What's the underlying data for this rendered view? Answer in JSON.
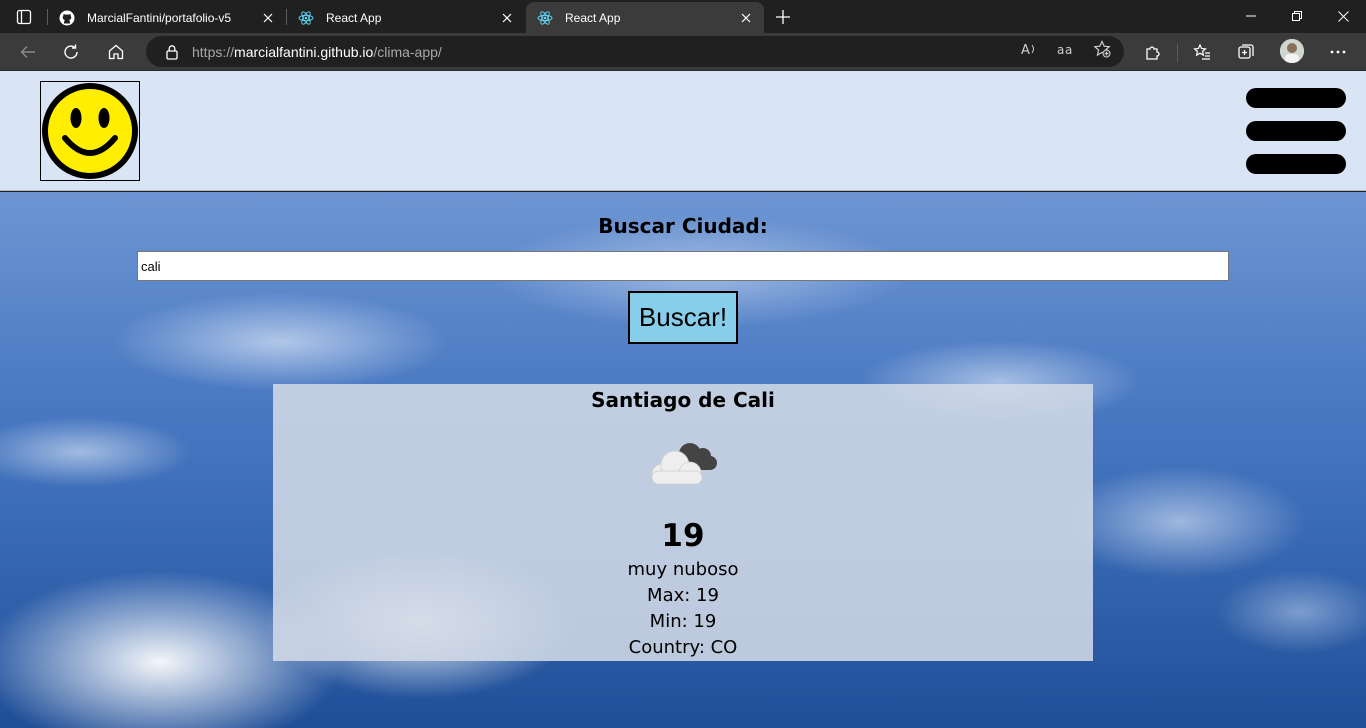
{
  "browser": {
    "tabs": [
      {
        "title": "MarcialFantini/portafolio-v5",
        "icon": "github-icon",
        "active": false
      },
      {
        "title": "React App",
        "icon": "react-icon",
        "active": false
      },
      {
        "title": "React App",
        "icon": "react-icon",
        "active": true
      }
    ],
    "url_prefix": "https://",
    "url_host": "marcialfantini.github.io",
    "url_path": "/clima-app/"
  },
  "app": {
    "logo_icon": "smiley-face-icon",
    "menu_icon": "hamburger-menu-icon",
    "search": {
      "title": "Buscar Ciudad:",
      "value": "cali",
      "button_label": "Buscar!"
    },
    "weather": {
      "city": "Santiago de Cali",
      "icon": "cloudy-icon",
      "temp": "19",
      "description": "muy nuboso",
      "max": "Max: 19",
      "min": "Min: 19",
      "country": "Country: CO"
    }
  },
  "colors": {
    "header_bg": "#d9e4f5",
    "button_bg": "#87ceeb",
    "smiley_fill": "#ffee00"
  }
}
